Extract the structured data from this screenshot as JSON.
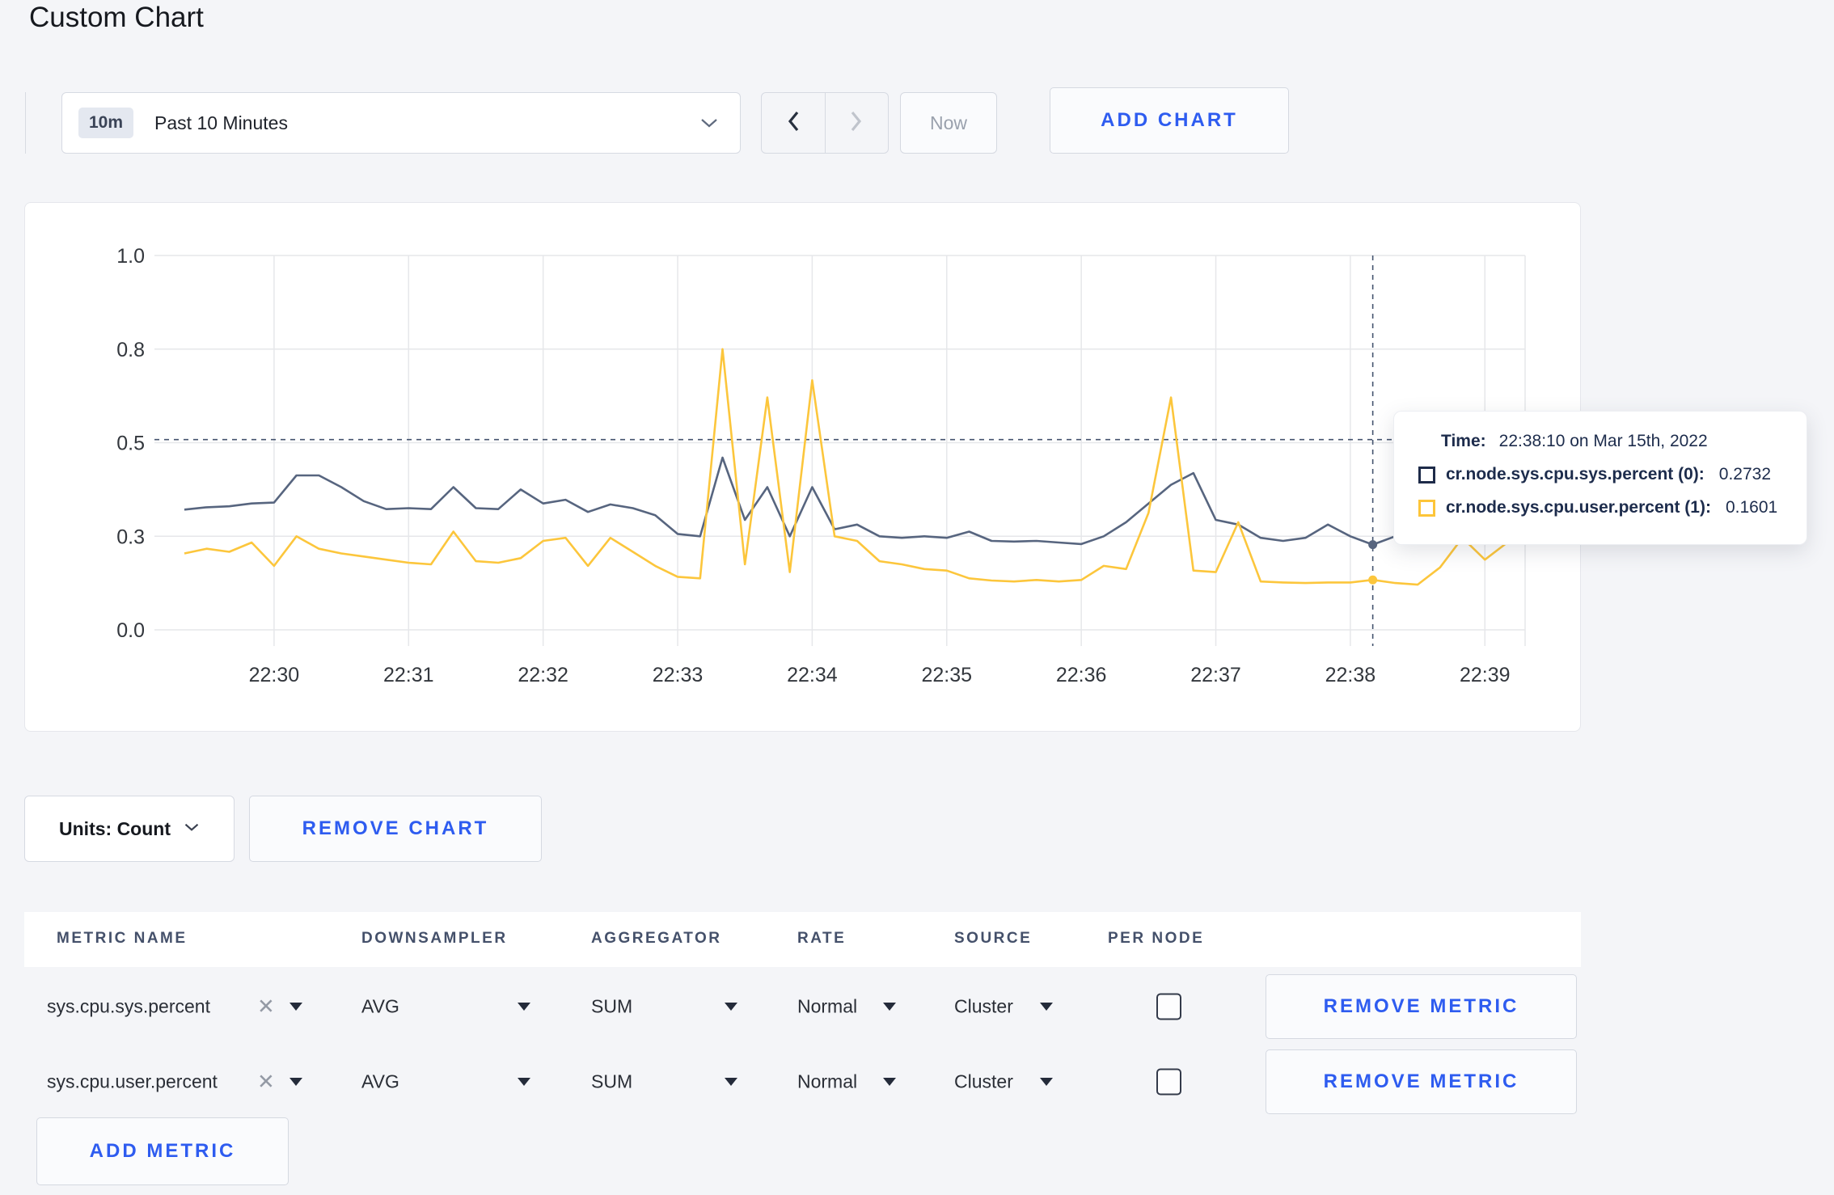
{
  "page": {
    "title": "Custom Chart",
    "accent_color": "#2e5cf0",
    "background_color": "#f4f5f8"
  },
  "toolbar": {
    "time_range": {
      "badge": "10m",
      "label": "Past 10 Minutes"
    },
    "now_label": "Now",
    "add_chart_label": "ADD CHART"
  },
  "chart_controls": {
    "units_label": "Units: Count",
    "remove_chart_label": "REMOVE CHART"
  },
  "tooltip": {
    "time_label": "Time:",
    "time_value": "22:38:10 on Mar 15th, 2022",
    "series": [
      {
        "name": "cr.node.sys.cpu.sys.percent (0):",
        "value": "0.2732",
        "swatch_color": "#1e2b49"
      },
      {
        "name": "cr.node.sys.cpu.user.percent (1):",
        "value": "0.1601",
        "swatch_color": "#fdc539"
      }
    ]
  },
  "chart_data": {
    "type": "line",
    "title": "",
    "xlabel": "",
    "ylabel": "",
    "grid": true,
    "legend_position": "tooltip",
    "start_time": "22:29:20",
    "interval_seconds": 10,
    "x_tick_labels": [
      "22:30",
      "22:31",
      "22:32",
      "22:33",
      "22:34",
      "22:35",
      "22:36",
      "22:37",
      "22:38",
      "22:39"
    ],
    "x_tick_indices": [
      4,
      10,
      16,
      22,
      28,
      34,
      40,
      46,
      52,
      58
    ],
    "y_tick_labels": [
      "0.0",
      "0.3",
      "0.5",
      "0.8",
      "1.0"
    ],
    "y_tick_values": [
      0,
      0.3,
      0.5,
      0.8,
      1.0
    ],
    "ylim": [
      0,
      1.0
    ],
    "crosshair": {
      "index": 53,
      "time": "22:38:10",
      "y_value": 0.51,
      "color": "#44536e"
    },
    "series": [
      {
        "name": "cr.node.sys.cpu.sys.percent (0)",
        "line_color": "#57657f",
        "swatch_color": "#1e2b49",
        "values": [
          0.357,
          0.362,
          0.364,
          0.37,
          0.372,
          0.43,
          0.43,
          0.405,
          0.375,
          0.358,
          0.36,
          0.358,
          0.405,
          0.36,
          0.358,
          0.4,
          0.37,
          0.378,
          0.352,
          0.368,
          0.36,
          0.345,
          0.305,
          0.3,
          0.468,
          0.335,
          0.405,
          0.3,
          0.405,
          0.315,
          0.325,
          0.3,
          0.295,
          0.3,
          0.295,
          0.31,
          0.285,
          0.283,
          0.285,
          0.28,
          0.275,
          0.3,
          0.33,
          0.37,
          0.41,
          0.435,
          0.335,
          0.325,
          0.295,
          0.285,
          0.295,
          0.325,
          0.3,
          0.2732,
          0.3,
          0.295,
          0.315,
          0.3,
          0.295,
          0.305
        ]
      },
      {
        "name": "cr.node.sys.cpu.user.percent (1)",
        "line_color": "#fcc63c",
        "swatch_color": "#fdc539",
        "values": [
          0.245,
          0.26,
          0.25,
          0.28,
          0.205,
          0.3,
          0.26,
          0.245,
          0.235,
          0.225,
          0.215,
          0.21,
          0.31,
          0.22,
          0.215,
          0.23,
          0.285,
          0.295,
          0.205,
          0.295,
          0.25,
          0.205,
          0.17,
          0.165,
          0.8,
          0.21,
          0.645,
          0.185,
          0.7,
          0.3,
          0.285,
          0.22,
          0.21,
          0.195,
          0.19,
          0.165,
          0.158,
          0.155,
          0.16,
          0.155,
          0.16,
          0.205,
          0.195,
          0.35,
          0.645,
          0.19,
          0.185,
          0.33,
          0.155,
          0.152,
          0.15,
          0.152,
          0.152,
          0.1601,
          0.15,
          0.145,
          0.2,
          0.295,
          0.225,
          0.28
        ]
      }
    ]
  },
  "metrics_table": {
    "headers": [
      "METRIC NAME",
      "DOWNSAMPLER",
      "AGGREGATOR",
      "RATE",
      "SOURCE",
      "PER NODE"
    ],
    "rows": [
      {
        "metric": "sys.cpu.sys.percent",
        "downsampler": "AVG",
        "aggregator": "SUM",
        "rate": "Normal",
        "source": "Cluster",
        "per_node_checked": false,
        "remove_label": "REMOVE METRIC"
      },
      {
        "metric": "sys.cpu.user.percent",
        "downsampler": "AVG",
        "aggregator": "SUM",
        "rate": "Normal",
        "source": "Cluster",
        "per_node_checked": false,
        "remove_label": "REMOVE METRIC"
      }
    ],
    "add_metric_label": "ADD METRIC"
  }
}
